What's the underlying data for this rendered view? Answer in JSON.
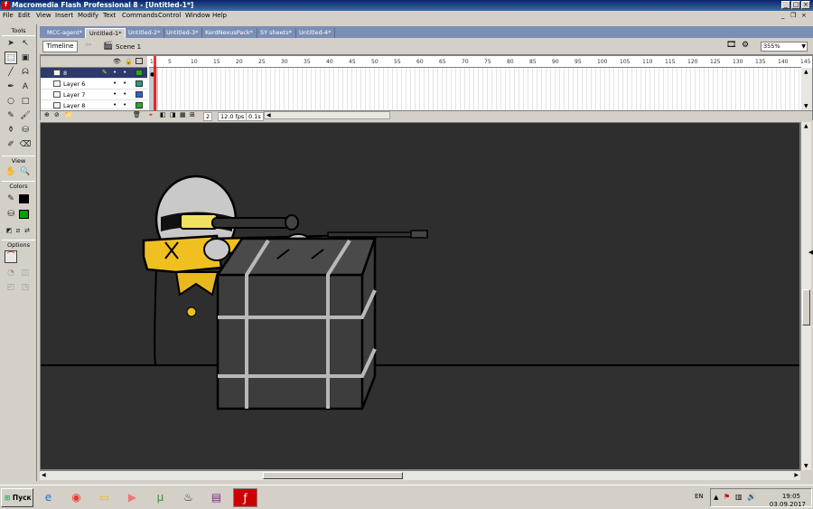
{
  "app": {
    "title": "Macromedia Flash Professional 8 - [Untitled-1*]",
    "icon": "flash-icon"
  },
  "menu": [
    "File",
    "Edit",
    "View",
    "Insert",
    "Modify",
    "Text",
    "Commands",
    "Control",
    "Window",
    "Help"
  ],
  "tools": {
    "header": "Tools",
    "view_header": "View",
    "colors_header": "Colors",
    "options_header": "Options",
    "stroke_color": "#000000",
    "fill_color": "#00a000"
  },
  "doc_tabs": [
    "MCC-agent*",
    "Untitled-1*",
    "Untitled-2*",
    "Untitled-3*",
    "KerdNexusPack*",
    "SY sheets*",
    "Untitled-4*"
  ],
  "active_tab_index": 1,
  "editbar": {
    "timeline_label": "Timeline",
    "scene_label": "Scene 1",
    "zoom": "355%"
  },
  "timeline": {
    "layers": [
      {
        "name": "8",
        "color": "#20b020",
        "selected": true
      },
      {
        "name": "Layer 6",
        "color": "#20a080",
        "selected": false
      },
      {
        "name": "Layer 7",
        "color": "#3060d0",
        "selected": false
      },
      {
        "name": "Layer 8",
        "color": "#20b020",
        "selected": false
      }
    ],
    "ticks": [
      "1",
      "5",
      "10",
      "15",
      "20",
      "25",
      "30",
      "35",
      "40",
      "45",
      "50",
      "55",
      "60",
      "65",
      "70",
      "75",
      "80",
      "85",
      "90",
      "95",
      "100",
      "105",
      "110",
      "115",
      "120",
      "125",
      "130",
      "135",
      "140",
      "145"
    ],
    "current_frame": "2",
    "fps": "12.0 fps",
    "time": "0.1s"
  },
  "taskbar": {
    "start_label": "Пуск",
    "lang": "EN",
    "time": "19:05",
    "date": "03.09.2017"
  }
}
